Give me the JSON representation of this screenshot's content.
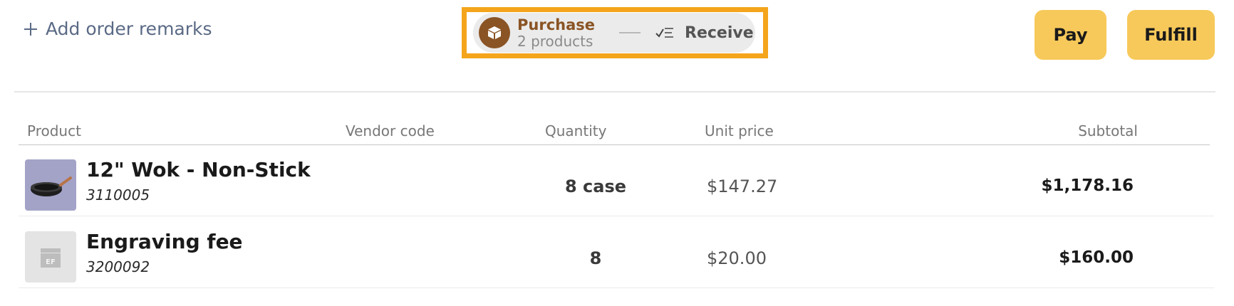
{
  "remarks": {
    "label": "Add order remarks",
    "icon": "plus-icon"
  },
  "stepper": {
    "purchase": {
      "title": "Purchase",
      "subtitle": "2 products",
      "icon": "box-icon"
    },
    "receive": {
      "label": "Receive",
      "icon": "checklist-icon"
    },
    "active_color": "#8a5425",
    "highlight_color": "#f4a51c"
  },
  "actions": {
    "pay_label": "Pay",
    "fulfill_label": "Fulfill",
    "button_color": "#f7c95a"
  },
  "table": {
    "columns": [
      "Product",
      "Vendor code",
      "Quantity",
      "Unit price",
      "Subtotal"
    ],
    "rows": [
      {
        "name": "12\" Wok - Non-Stick",
        "sku": "3110005",
        "vendor_code": "",
        "quantity": "8 case",
        "unit_price": "$147.27",
        "subtotal": "$1,178.16",
        "thumb": "wok-image"
      },
      {
        "name": "Engraving fee",
        "sku": "3200092",
        "vendor_code": "",
        "quantity": "8",
        "unit_price": "$20.00",
        "subtotal": "$160.00",
        "thumb": "box-placeholder-icon",
        "thumb_text": "EF"
      }
    ]
  }
}
